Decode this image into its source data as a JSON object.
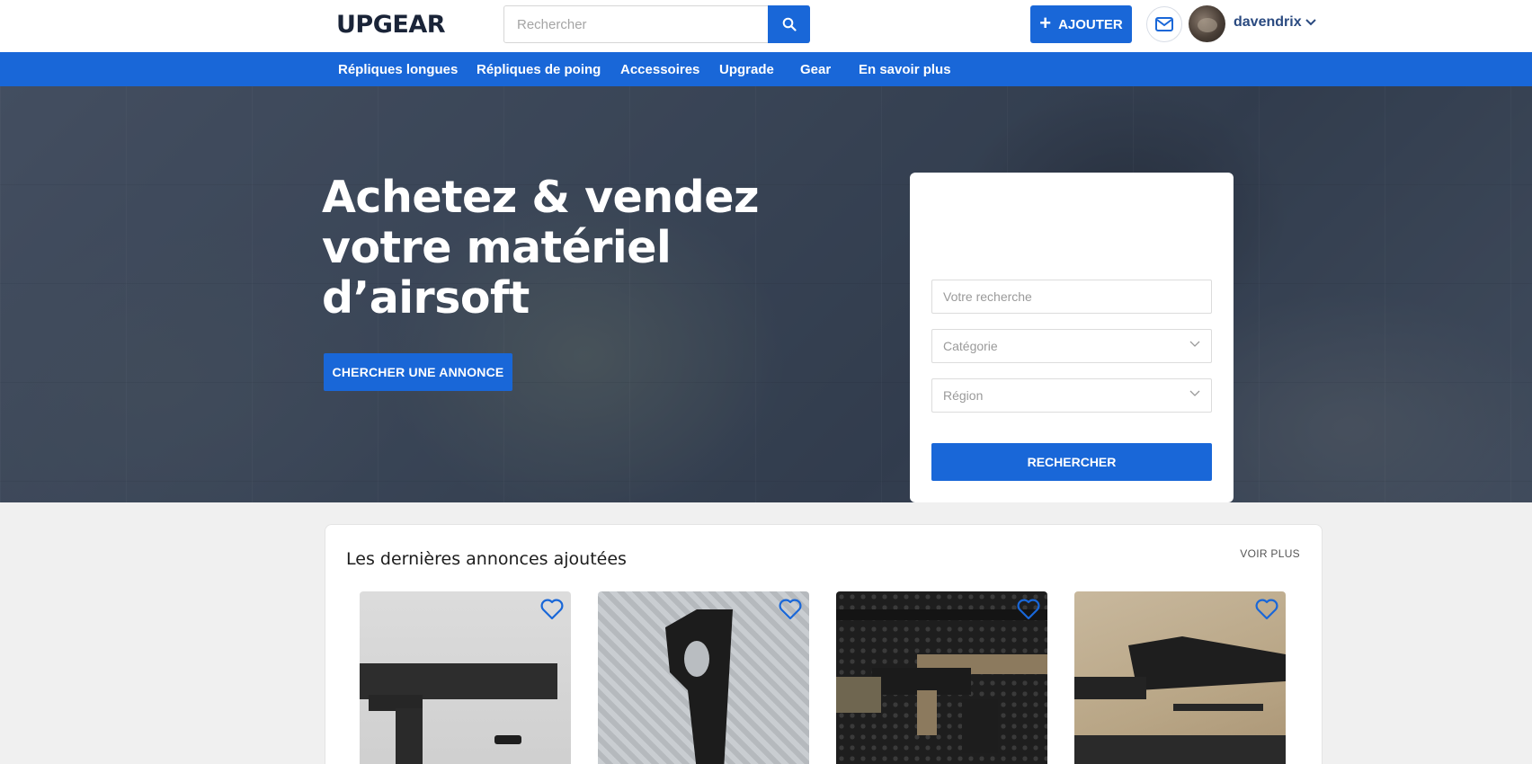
{
  "header": {
    "logo": "UPGEAR",
    "search_placeholder": "Rechercher",
    "add_label": "AJOUTER",
    "username": "davendrix"
  },
  "nav": {
    "items": [
      "Répliques longues",
      "Répliques de poing",
      "Accessoires",
      "Upgrade",
      "Gear",
      "En savoir plus"
    ]
  },
  "hero": {
    "title": "Achetez & vendez votre matériel d’airsoft",
    "cta_label": "CHERCHER UNE ANNONCE"
  },
  "search_card": {
    "query_placeholder": "Votre recherche",
    "category_placeholder": "Catégorie",
    "region_placeholder": "Région",
    "submit_label": "RECHERCHER"
  },
  "listings": {
    "title": "Les dernières annonces ajoutées",
    "more_label": "VOIR PLUS",
    "count": 4
  },
  "colors": {
    "brand_blue": "#1967d8",
    "logo_navy": "#1a2438",
    "username": "#2a4a80"
  }
}
